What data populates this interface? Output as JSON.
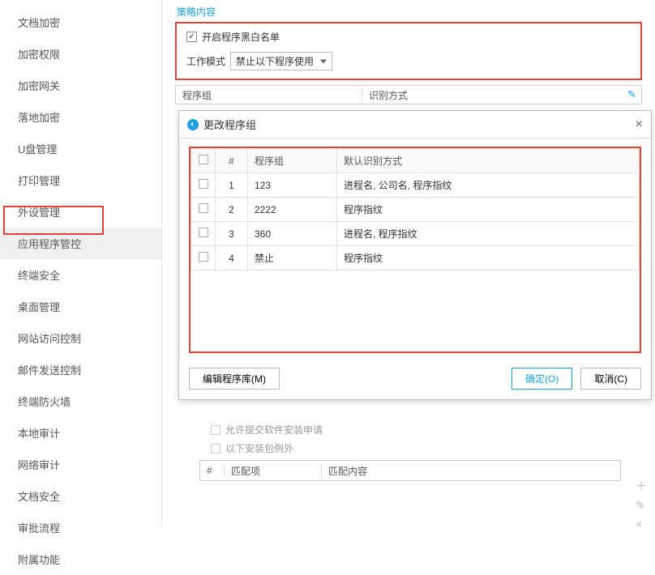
{
  "sidebar": {
    "items": [
      {
        "label": "文档加密"
      },
      {
        "label": "加密权限"
      },
      {
        "label": "加密网关"
      },
      {
        "label": "落地加密"
      },
      {
        "label": "U盘管理"
      },
      {
        "label": "打印管理"
      },
      {
        "label": "外设管理"
      },
      {
        "label": "应用程序管控",
        "active": true
      },
      {
        "label": "终端安全"
      },
      {
        "label": "桌面管理"
      },
      {
        "label": "网站访问控制"
      },
      {
        "label": "邮件发送控制"
      },
      {
        "label": "终端防火墙"
      },
      {
        "label": "本地审计"
      },
      {
        "label": "网络审计"
      },
      {
        "label": "文档安全"
      },
      {
        "label": "审批流程"
      },
      {
        "label": "附属功能"
      }
    ]
  },
  "policy": {
    "section_title": "策略内容",
    "enable_label": "开启程序黑白名单",
    "enable_checked": true,
    "mode_label": "工作模式",
    "mode_value": "禁止以下程序使用",
    "col_program_group": "程序组",
    "col_detect": "识别方式"
  },
  "dialog": {
    "title": "更改程序组",
    "headers": {
      "num": "#",
      "group": "程序组",
      "detect": "默认识别方式"
    },
    "rows": [
      {
        "n": "1",
        "group": "123",
        "detect": "进程名, 公司名, 程序指纹"
      },
      {
        "n": "2",
        "group": "2222",
        "detect": "程序指纹"
      },
      {
        "n": "3",
        "group": "360",
        "detect": "进程名, 程序指纹"
      },
      {
        "n": "4",
        "group": "禁止",
        "detect": "程序指纹"
      }
    ],
    "edit_lib_btn": "编辑程序库(M)",
    "ok_btn": "确定(O)",
    "cancel_btn": "取消(C)"
  },
  "lower": {
    "opt1": "允许提交软件安装申请",
    "opt2": "以下安装包例外",
    "headers": {
      "num": "#",
      "match_field": "匹配项",
      "match_content": "匹配内容"
    }
  }
}
